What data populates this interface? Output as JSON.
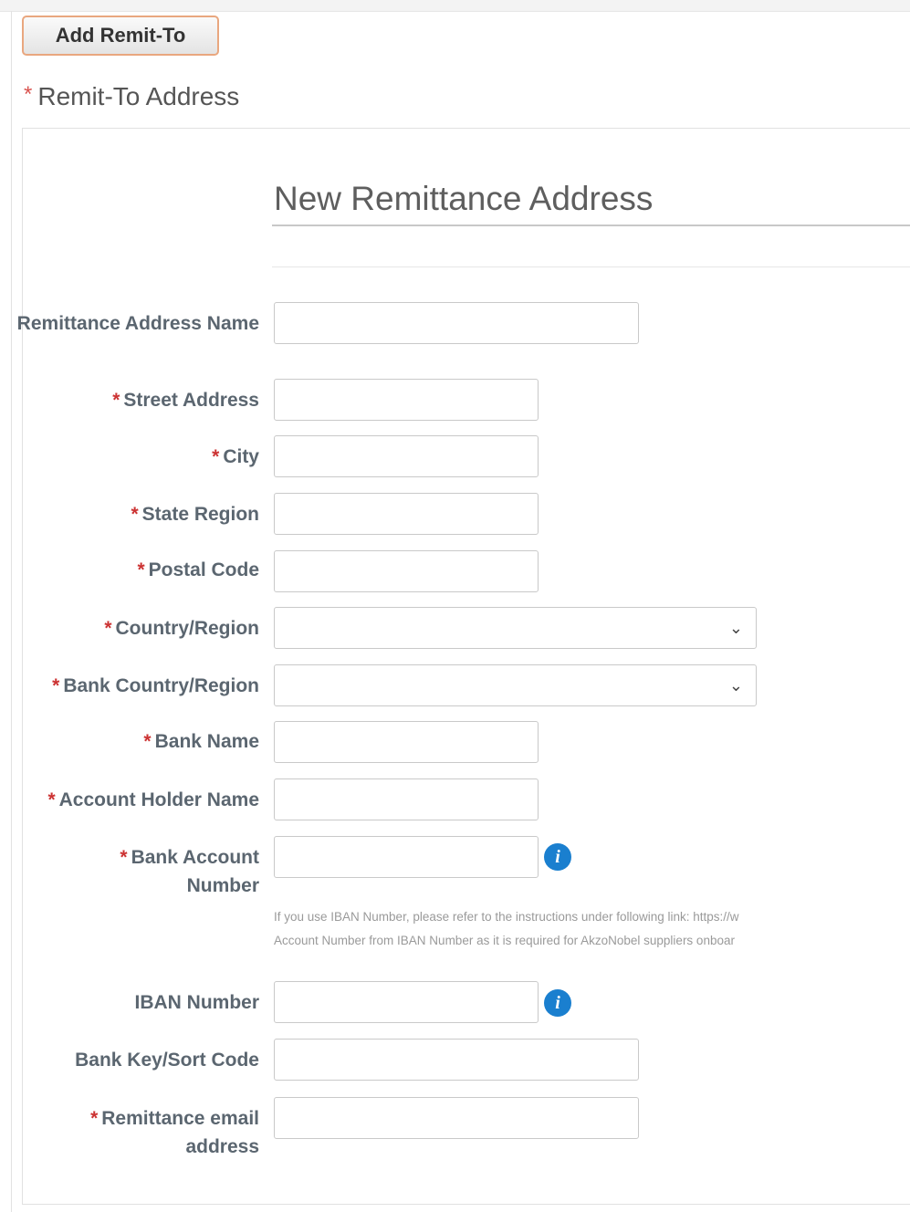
{
  "add_button": "Add Remit-To",
  "section": {
    "required_mark": "*",
    "title": "Remit-To Address"
  },
  "form": {
    "title": "New Remittance Address",
    "required_mark": "*",
    "fields": {
      "remittance_name": {
        "label": "Remittance Address Name",
        "value": ""
      },
      "street": {
        "label": "Street Address",
        "value": ""
      },
      "city": {
        "label": "City",
        "value": ""
      },
      "state": {
        "label": "State Region",
        "value": ""
      },
      "postal": {
        "label": "Postal Code",
        "value": ""
      },
      "country": {
        "label": "Country/Region",
        "value": ""
      },
      "bank_country": {
        "label": "Bank Country/Region",
        "value": ""
      },
      "bank_name": {
        "label": "Bank Name",
        "value": ""
      },
      "holder": {
        "label": "Account Holder Name",
        "value": ""
      },
      "account_number": {
        "label": "Bank Account Number",
        "value": ""
      },
      "iban": {
        "label": "IBAN Number",
        "value": ""
      },
      "sort_code": {
        "label": "Bank Key/Sort Code",
        "value": ""
      },
      "email": {
        "label": "Remittance email address",
        "value": ""
      }
    },
    "help_line1": "If you use IBAN Number, please refer to the instructions under following link: https://w",
    "help_line2": "Account Number from IBAN Number as it is required for AkzoNobel suppliers onboar"
  },
  "icons": {
    "info": "info-icon",
    "dropdown": "chevron-down-icon"
  },
  "colors": {
    "required": "#cc3333",
    "info": "#1a7fcf",
    "button_border": "#e9a77f"
  }
}
